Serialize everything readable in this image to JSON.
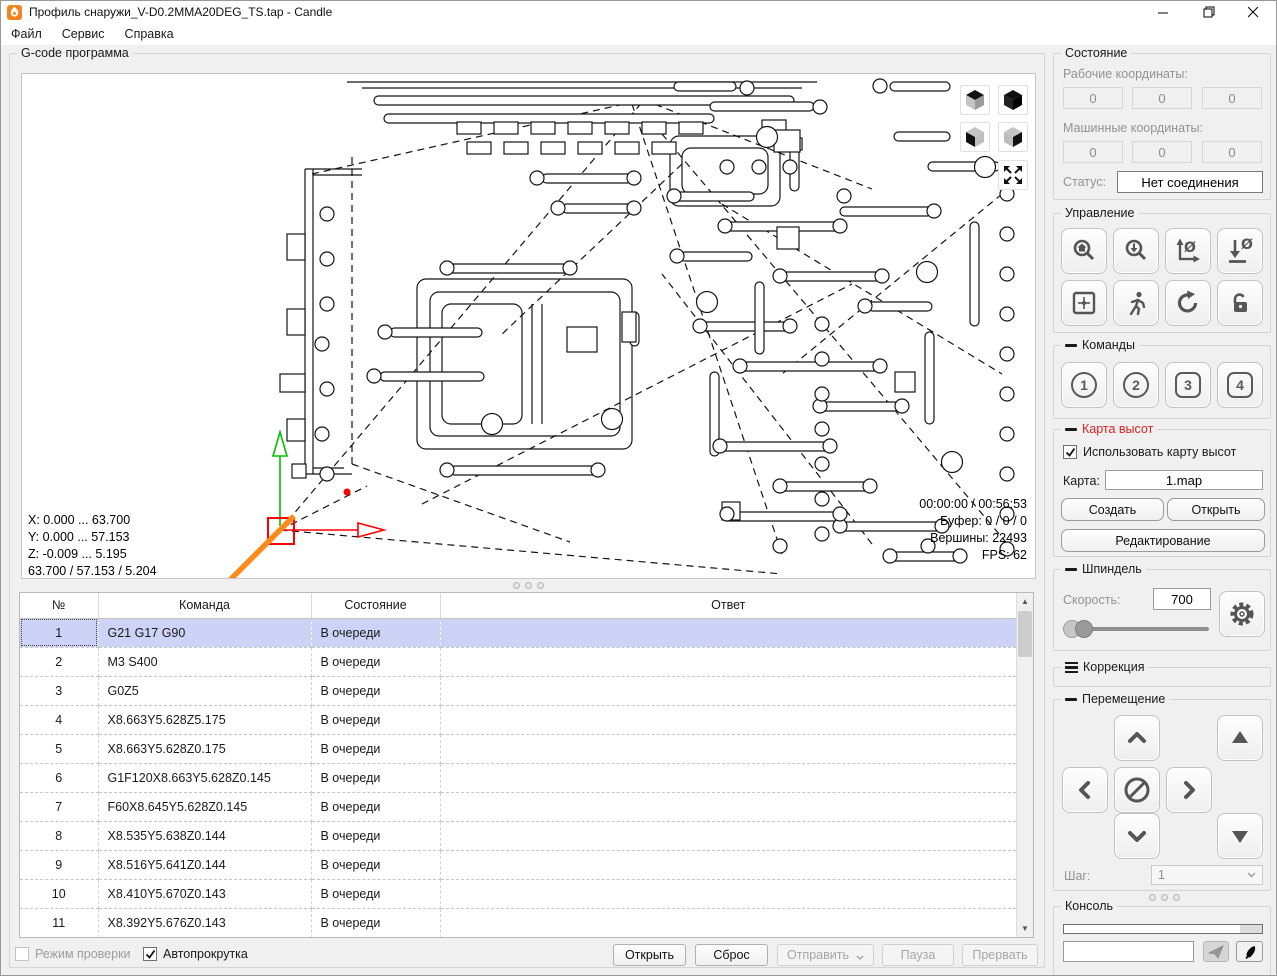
{
  "window": {
    "title": "Профиль снаружи_V-D0.2MMA20DEG_TS.tap - Candle"
  },
  "menu": {
    "items": [
      "Файл",
      "Сервис",
      "Справка"
    ]
  },
  "viewport": {
    "group_title": "G-code программа",
    "bounds_x": "X: 0.000 ... 63.700",
    "bounds_y": "Y: 0.000 ... 57.153",
    "bounds_z": "Z: -0.009 ... 5.195",
    "dimensions": "63.700 / 57.153 / 5.204",
    "time": "00:00:00 / 00:56:53",
    "buffer": "Буфер: 0 / 0 / 0",
    "vertices": "Вершины: 22493",
    "fps": "FPS: 62"
  },
  "table": {
    "headers": [
      "№",
      "Команда",
      "Состояние",
      "Ответ"
    ],
    "rows": [
      {
        "n": "1",
        "cmd": "G21 G17 G90",
        "state": "В очереди",
        "resp": ""
      },
      {
        "n": "2",
        "cmd": "M3 S400",
        "state": "В очереди",
        "resp": ""
      },
      {
        "n": "3",
        "cmd": "G0Z5",
        "state": "В очереди",
        "resp": ""
      },
      {
        "n": "4",
        "cmd": "X8.663Y5.628Z5.175",
        "state": "В очереди",
        "resp": ""
      },
      {
        "n": "5",
        "cmd": "X8.663Y5.628Z0.175",
        "state": "В очереди",
        "resp": ""
      },
      {
        "n": "6",
        "cmd": "G1F120X8.663Y5.628Z0.145",
        "state": "В очереди",
        "resp": ""
      },
      {
        "n": "7",
        "cmd": "F60X8.645Y5.628Z0.145",
        "state": "В очереди",
        "resp": ""
      },
      {
        "n": "8",
        "cmd": "X8.535Y5.638Z0.144",
        "state": "В очереди",
        "resp": ""
      },
      {
        "n": "9",
        "cmd": "X8.516Y5.641Z0.144",
        "state": "В очереди",
        "resp": ""
      },
      {
        "n": "10",
        "cmd": "X8.410Y5.670Z0.143",
        "state": "В очереди",
        "resp": ""
      },
      {
        "n": "11",
        "cmd": "X8.392Y5.676Z0.143",
        "state": "В очереди",
        "resp": ""
      }
    ],
    "selected_row": 1
  },
  "bottom_bar": {
    "check_mode": "Режим проверки",
    "autoscroll": "Автопрокрутка",
    "open": "Открыть",
    "reset": "Сброс",
    "send": "Отправить",
    "pause": "Пауза",
    "abort": "Прервать"
  },
  "state_panel": {
    "title": "Состояние",
    "work_label": "Рабочие координаты:",
    "machine_label": "Машинные координаты:",
    "work": [
      "0",
      "0",
      "0"
    ],
    "machine": [
      "0",
      "0",
      "0"
    ],
    "status_label": "Статус:",
    "status": "Нет соединения"
  },
  "control_panel": {
    "title": "Управление"
  },
  "commands_panel": {
    "title": "Команды",
    "buttons": [
      "1",
      "2",
      "3",
      "4"
    ]
  },
  "heightmap_panel": {
    "title": "Карта высот",
    "use_label": "Использовать карту высот",
    "map_label": "Карта:",
    "map_value": "1.map",
    "create": "Создать",
    "open": "Открыть",
    "edit": "Редактирование",
    "title_color": "#e02020"
  },
  "spindle_panel": {
    "title": "Шпиндель",
    "speed_label": "Скорость:",
    "speed": "700"
  },
  "override_panel": {
    "title": "Коррекция"
  },
  "jog_panel": {
    "title": "Перемещение",
    "step_label": "Шаг:",
    "step": "1"
  },
  "console_panel": {
    "title": "Консоль",
    "input_value": ""
  },
  "colors": {
    "selection": "#ccd3f6",
    "axis_x": "#ff0000",
    "axis_y": "#00c000",
    "tool_path": "#ff8c1a"
  }
}
